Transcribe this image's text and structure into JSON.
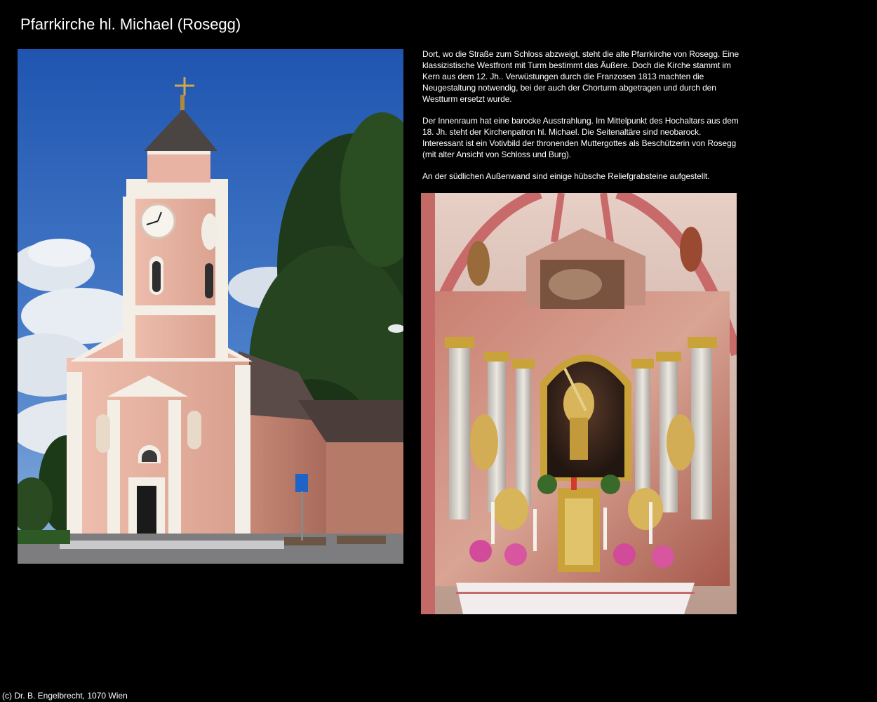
{
  "page": {
    "title": "Pfarrkirche hl. Michael (Rosegg)",
    "paragraphs": [
      "Dort, wo die Straße zum Schloss abzweigt, steht die alte Pfarrkirche von Rosegg. Eine klassizistische Westfront mit Turm bestimmt das Äußere. Doch die Kirche stammt im Kern aus dem 12. Jh.. Verwüstungen durch die Franzosen 1813 machten die Neugestaltung notwendig, bei der auch der Chorturm abgetragen und durch den Westturm ersetzt wurde.",
      "Der Innenraum hat eine barocke Ausstrahlung. Im Mittelpunkt des Hochaltars aus dem 18. Jh. steht der Kirchenpatron hl. Michael. Die Seitenaltäre sind neobarock. Interessant ist ein Votivbild der thronenden Muttergottes als Beschützerin von Rosegg (mit alter Ansicht von Schloss und Burg).",
      "An der südlichen Außenwand sind einige hübsche Reliefgrabsteine aufgestellt."
    ],
    "footer": "(c) Dr. B. Engelbrecht, 1070 Wien"
  },
  "photos": {
    "exterior": "church-exterior-photo",
    "interior": "high-altar-photo"
  },
  "colors": {
    "background": "#000000",
    "text": "#ffffff",
    "sky": "#2f63b8",
    "church_wall": "#e8b3a3",
    "church_trim": "#f4efe6",
    "altar_gold": "#c9a23a"
  }
}
